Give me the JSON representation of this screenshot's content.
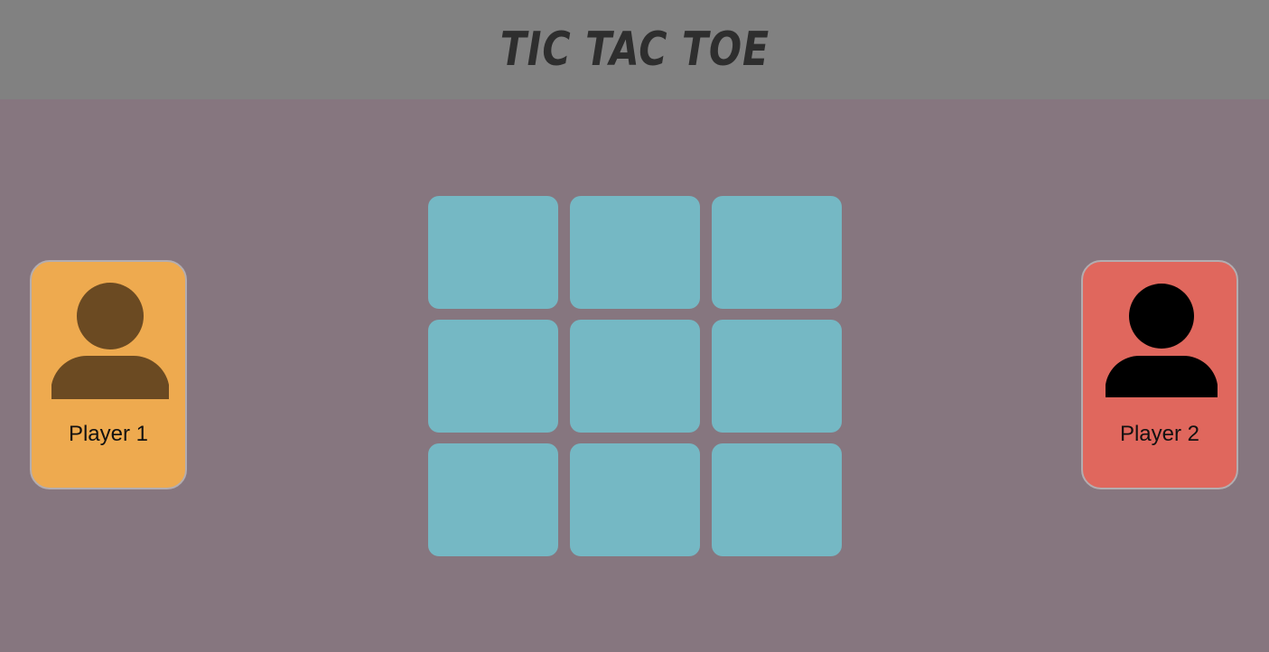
{
  "header": {
    "title": "Tic Tac Toe"
  },
  "colors": {
    "background": "#86767f",
    "header": "#818181",
    "cell": "#75b8c4",
    "player1_card": "#eeaa4f",
    "player1_icon": "#6b4a22",
    "player2_card": "#e0675d",
    "player2_icon": "#000000"
  },
  "players": [
    {
      "label": "Player 1",
      "icon": "user-icon"
    },
    {
      "label": "Player 2",
      "icon": "user-icon"
    }
  ],
  "board": {
    "cells": [
      "",
      "",
      "",
      "",
      "",
      "",
      "",
      "",
      ""
    ]
  }
}
